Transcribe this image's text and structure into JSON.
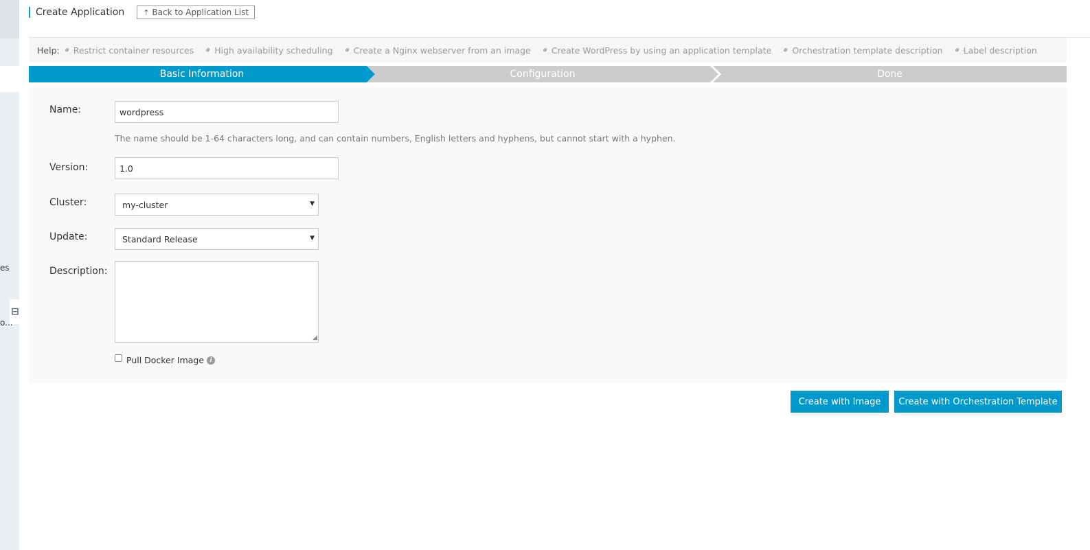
{
  "sidebar": {
    "items": [
      "es",
      "o..."
    ]
  },
  "header": {
    "title": "Create Application",
    "back_label": "Back to Application List"
  },
  "help": {
    "label": "Help:",
    "links": [
      "Restrict container resources",
      "High availability scheduling",
      "Create a Nginx webserver from an image",
      "Create WordPress by using an application template",
      "Orchestration template description",
      "Label description"
    ]
  },
  "steps": [
    "Basic Information",
    "Configuration",
    "Done"
  ],
  "form": {
    "name_label": "Name:",
    "name_value": "wordpress",
    "name_hint": "The name should be 1-64 characters long, and can contain numbers, English letters and hyphens, but cannot start with a hyphen.",
    "version_label": "Version:",
    "version_value": "1.0",
    "cluster_label": "Cluster:",
    "cluster_value": "my-cluster",
    "update_label": "Update:",
    "update_value": "Standard Release",
    "description_label": "Description:",
    "description_value": "",
    "pull_label": "Pull Docker Image"
  },
  "actions": {
    "create_image": "Create with Image",
    "create_template": "Create with Orchestration Template"
  },
  "colors": {
    "accent": "#0099cc",
    "step_inactive": "#cccccc",
    "panel_bg": "#f9f9f9"
  }
}
